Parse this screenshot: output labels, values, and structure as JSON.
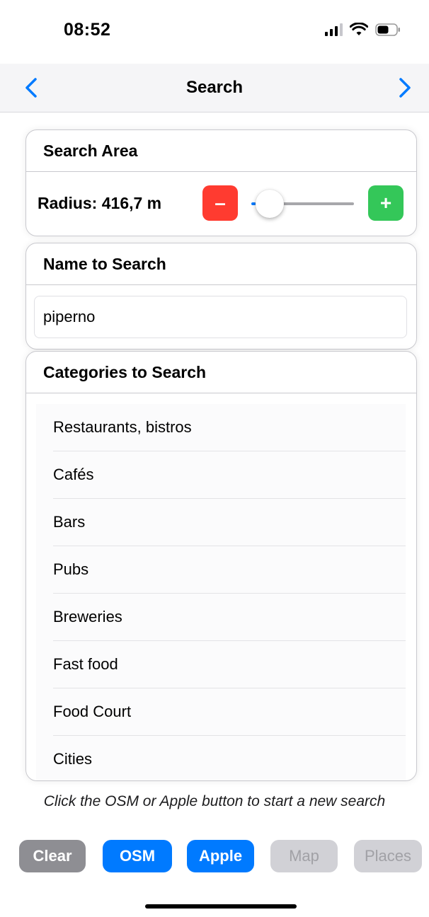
{
  "status_bar": {
    "time": "08:52"
  },
  "nav": {
    "title": "Search"
  },
  "search_area": {
    "title": "Search Area",
    "radius_label": "Radius: 416,7 m",
    "minus_label": "–",
    "plus_label": "+",
    "slider_level": 0.03
  },
  "name_section": {
    "title": "Name to Search",
    "value": "piperno"
  },
  "categories_section": {
    "title": "Categories to Search",
    "items": [
      {
        "label": "Restaurants, bistros"
      },
      {
        "label": "Cafés"
      },
      {
        "label": "Bars"
      },
      {
        "label": "Pubs"
      },
      {
        "label": "Breweries"
      },
      {
        "label": "Fast food"
      },
      {
        "label": "Food Court"
      },
      {
        "label": "Cities"
      }
    ]
  },
  "hint": "Click the OSM or Apple button to start a new search",
  "buttons": {
    "clear": "Clear",
    "osm": "OSM",
    "apple": "Apple",
    "map": "Map",
    "places": "Places"
  },
  "colors": {
    "accent": "#007aff",
    "minus": "#ff3b30",
    "plus": "#34c759",
    "disabled": "#d1d1d6",
    "clear": "#8e8e93"
  }
}
